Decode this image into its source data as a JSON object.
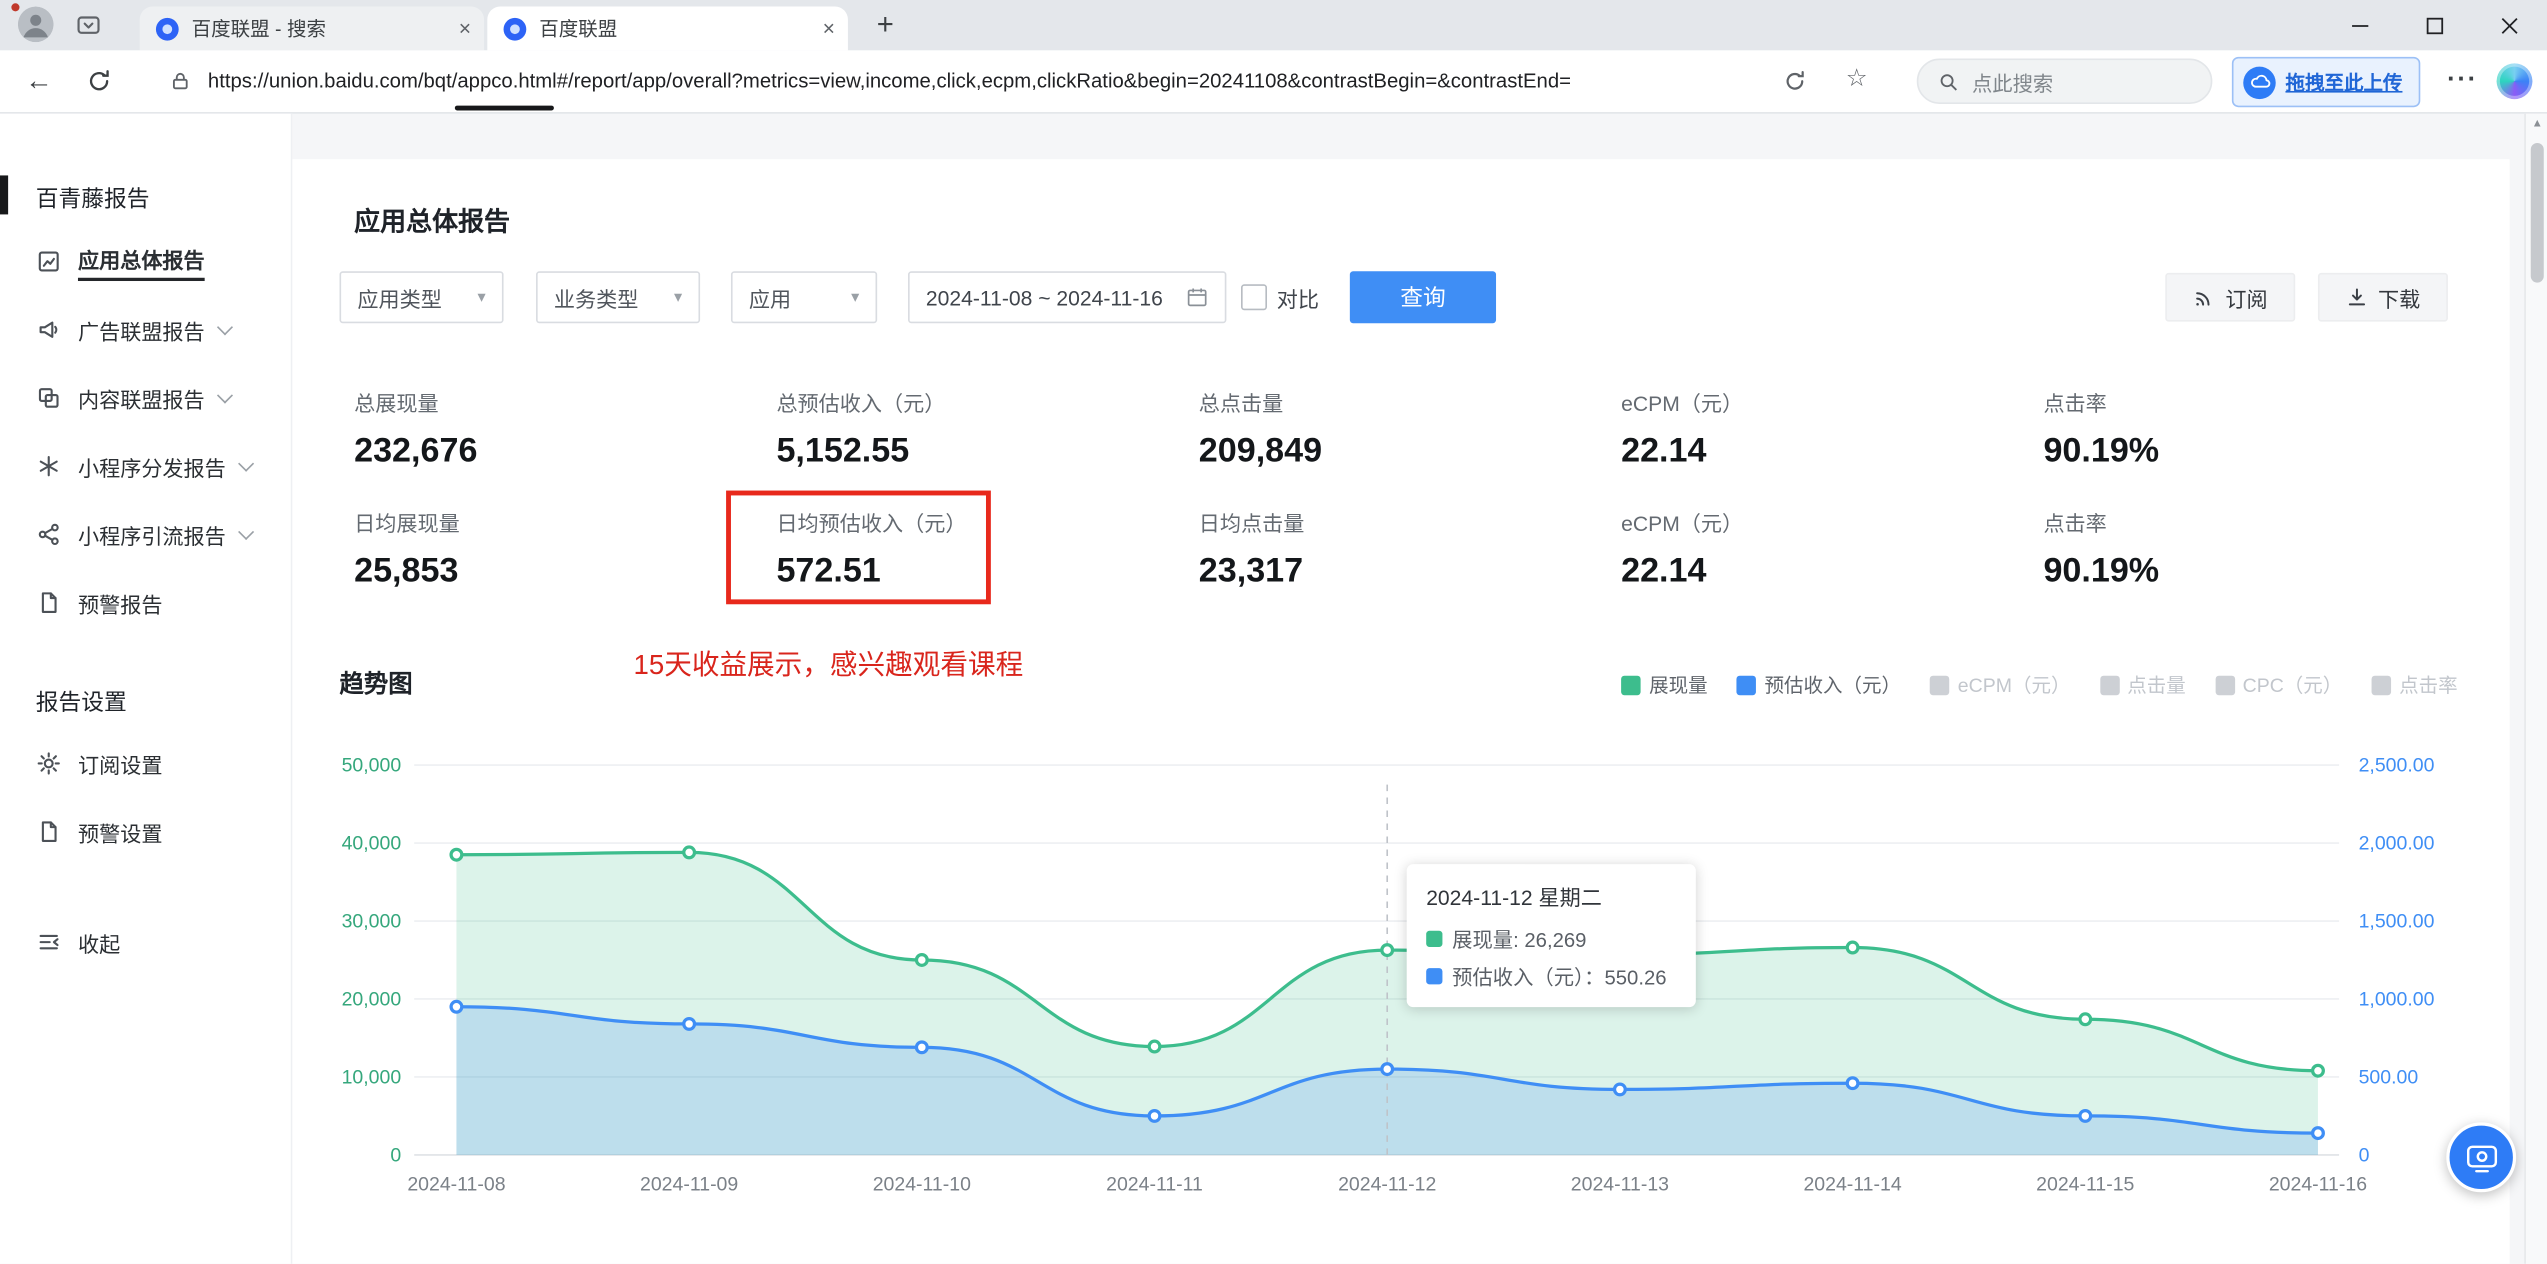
{
  "browser": {
    "tabs": [
      {
        "title": "百度联盟 - 搜索",
        "active": false
      },
      {
        "title": "百度联盟",
        "active": true
      }
    ],
    "toolbar": {
      "url": "https://union.baidu.com/bqt/appco.html#/report/app/overall?metrics=view,income,click,ecpm,clickRatio&begin=20241108&contrastBegin=&contrastEnd=",
      "search_placeholder": "点此搜索",
      "upload_label": "拖拽至此上传"
    }
  },
  "sidebar": {
    "report_section_title": "百青藤报告",
    "report_items": [
      {
        "label": "应用总体报告",
        "icon": "overview",
        "active": true,
        "expandable": false
      },
      {
        "label": "广告联盟报告",
        "icon": "ad",
        "active": false,
        "expandable": true
      },
      {
        "label": "内容联盟报告",
        "icon": "content",
        "active": false,
        "expandable": true
      },
      {
        "label": "小程序分发报告",
        "icon": "distribute",
        "active": false,
        "expandable": true
      },
      {
        "label": "小程序引流报告",
        "icon": "referral",
        "active": false,
        "expandable": true
      },
      {
        "label": "预警报告",
        "icon": "alert",
        "active": false,
        "expandable": false
      }
    ],
    "settings_section_title": "报告设置",
    "settings_items": [
      {
        "label": "订阅设置",
        "icon": "gear"
      },
      {
        "label": "预警设置",
        "icon": "alert"
      }
    ],
    "collapse_label": "收起"
  },
  "main": {
    "page_title": "应用总体报告",
    "filters": {
      "app_type": "应用类型",
      "business_type": "业务类型",
      "app": "应用",
      "date_range": "2024-11-08 ~ 2024-11-16",
      "compare_label": "对比",
      "query_button": "查询",
      "subscribe_button": "订阅",
      "download_button": "下载"
    },
    "stats": {
      "rows": [
        [
          {
            "label": "总展现量",
            "value": "232,676"
          },
          {
            "label": "总预估收入（元）",
            "value": "5,152.55"
          },
          {
            "label": "总点击量",
            "value": "209,849"
          },
          {
            "label": "eCPM（元）",
            "value": "22.14"
          },
          {
            "label": "点击率",
            "value": "90.19%"
          }
        ],
        [
          {
            "label": "日均展现量",
            "value": "25,853"
          },
          {
            "label": "日均预估收入（元）",
            "value": "572.51",
            "highlight": true
          },
          {
            "label": "日均点击量",
            "value": "23,317"
          },
          {
            "label": "eCPM（元）",
            "value": "22.14"
          },
          {
            "label": "点击率",
            "value": "90.19%"
          }
        ]
      ]
    },
    "annotation": "15天收益展示，感兴趣观看课程",
    "trend_title": "趋势图",
    "legend": [
      {
        "label": "展现量",
        "color": "#3dbd8d",
        "active": true
      },
      {
        "label": "预估收入（元）",
        "color": "#3f8ef5",
        "active": true
      },
      {
        "label": "eCPM（元）",
        "color": "#cdd0d5",
        "active": false
      },
      {
        "label": "点击量",
        "color": "#cdd0d5",
        "active": false
      },
      {
        "label": "CPC（元）",
        "color": "#cdd0d5",
        "active": false
      },
      {
        "label": "点击率",
        "color": "#cdd0d5",
        "active": false
      }
    ]
  },
  "chart_data": {
    "type": "area",
    "title": "趋势图",
    "categories": [
      "2024-11-08",
      "2024-11-09",
      "2024-11-10",
      "2024-11-11",
      "2024-11-12",
      "2024-11-13",
      "2024-11-14",
      "2024-11-15",
      "2024-11-16"
    ],
    "series": [
      {
        "name": "展现量",
        "axis": "left",
        "color": "#3dbd8d",
        "fill": "rgba(61,189,141,0.18)",
        "values": [
          38500,
          38800,
          25000,
          13900,
          26269,
          25700,
          26600,
          17400,
          10800
        ]
      },
      {
        "name": "预估收入（元）",
        "axis": "right",
        "color": "#3f8ef5",
        "fill": "rgba(63,142,245,0.20)",
        "values": [
          950,
          840,
          690,
          250,
          550.26,
          420,
          460,
          250,
          140
        ]
      }
    ],
    "y_left": {
      "min": 0,
      "max": 50000,
      "tick_labels": [
        "0",
        "10,000",
        "20,000",
        "30,000",
        "40,000",
        "50,000"
      ]
    },
    "y_right": {
      "min": 0,
      "max": 2500,
      "tick_labels": [
        "0",
        "500.00",
        "1,000.00",
        "1,500.00",
        "2,000.00",
        "2,500.00"
      ]
    },
    "axis_colors": {
      "left": "#35a77c",
      "right": "#3f8ef5",
      "x": "#7b8188"
    },
    "grid": true,
    "legend_position": "top-right",
    "highlight_index": 4,
    "tooltip": {
      "title": "2024-11-12 星期二",
      "rows": [
        {
          "swatch": "#3dbd8d",
          "text": "展现量: 26,269"
        },
        {
          "swatch": "#3f8ef5",
          "text": "预估收入（元）：550.26"
        }
      ]
    }
  }
}
